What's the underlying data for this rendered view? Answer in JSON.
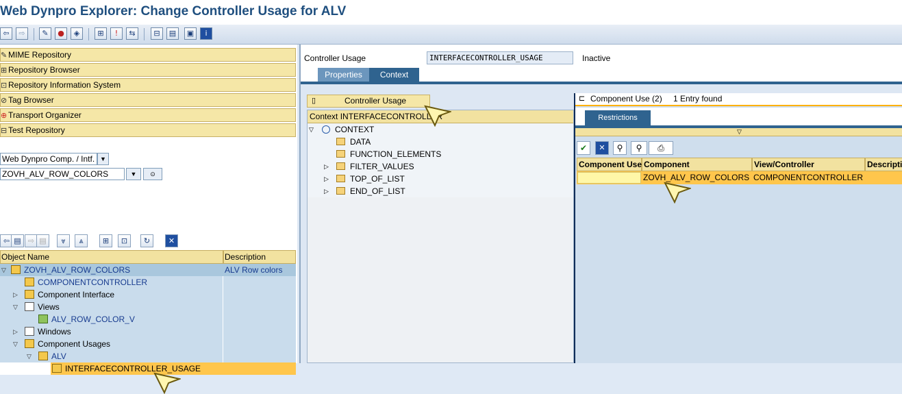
{
  "window": {
    "title": "Web Dynpro Explorer: Change Controller Usage for ALV"
  },
  "toolbar": {
    "icons": [
      "back-icon",
      "forward-icon",
      "edit-icon",
      "check-icon",
      "activate-icon",
      "where-used-icon",
      "info-icon",
      "navigate-icon",
      "hierarchy-icon",
      "display-object-list-icon",
      "window-icon",
      "information-icon"
    ]
  },
  "left": {
    "tools": [
      {
        "label": "MIME Repository",
        "icon": "mime-icon"
      },
      {
        "label": "Repository Browser",
        "icon": "repository-icon"
      },
      {
        "label": "Repository Information System",
        "icon": "info-system-icon"
      },
      {
        "label": "Tag Browser",
        "icon": "tag-icon"
      },
      {
        "label": "Transport Organizer",
        "icon": "transport-icon"
      },
      {
        "label": "Test Repository",
        "icon": "test-icon"
      }
    ],
    "object_type": "Web Dynpro Comp. / Intf.",
    "object_name": "ZOVH_ALV_ROW_COLORS",
    "columns": {
      "name": "Object Name",
      "description": "Description"
    },
    "tree": [
      {
        "label": "ZOVH_ALV_ROW_COLORS",
        "description": "ALV Row colors"
      },
      {
        "label": "COMPONENTCONTROLLER",
        "description": ""
      },
      {
        "label": "Component Interface",
        "description": ""
      },
      {
        "label": "Views",
        "description": ""
      },
      {
        "label": "ALV_ROW_COLOR_V",
        "description": ""
      },
      {
        "label": "Windows",
        "description": ""
      },
      {
        "label": "Component Usages",
        "description": ""
      },
      {
        "label": "ALV",
        "description": ""
      },
      {
        "label": "INTERFACECONTROLLER_USAGE",
        "description": ""
      }
    ]
  },
  "main": {
    "field_label": "Controller Usage",
    "field_value": "INTERFACECONTROLLER_USAGE",
    "status": "Inactive",
    "tabs": [
      "Properties",
      "Context"
    ],
    "controller_usage_button": "Controller Usage",
    "context_header": "Context INTERFACECONTROLLER",
    "context_tree": [
      "CONTEXT",
      "DATA",
      "FUNCTION_ELEMENTS",
      "FILTER_VALUES",
      "TOP_OF_LIST",
      "END_OF_LIST"
    ]
  },
  "popup": {
    "title": "Component Use (2)",
    "entries": "1 Entry found",
    "tab": "Restrictions",
    "columns": [
      "Component Use",
      "Component",
      "View/Controller",
      "Descripti"
    ],
    "rows": [
      {
        "component_use": "",
        "component": "ZOVH_ALV_ROW_COLORS",
        "view": "COMPONENTCONTROLLER",
        "description": ""
      }
    ]
  },
  "colors": {
    "accent": "#1f4f7f",
    "selected": "#ffc64c",
    "header": "#f2e2a0",
    "tab_active": "#3a6c9a"
  }
}
